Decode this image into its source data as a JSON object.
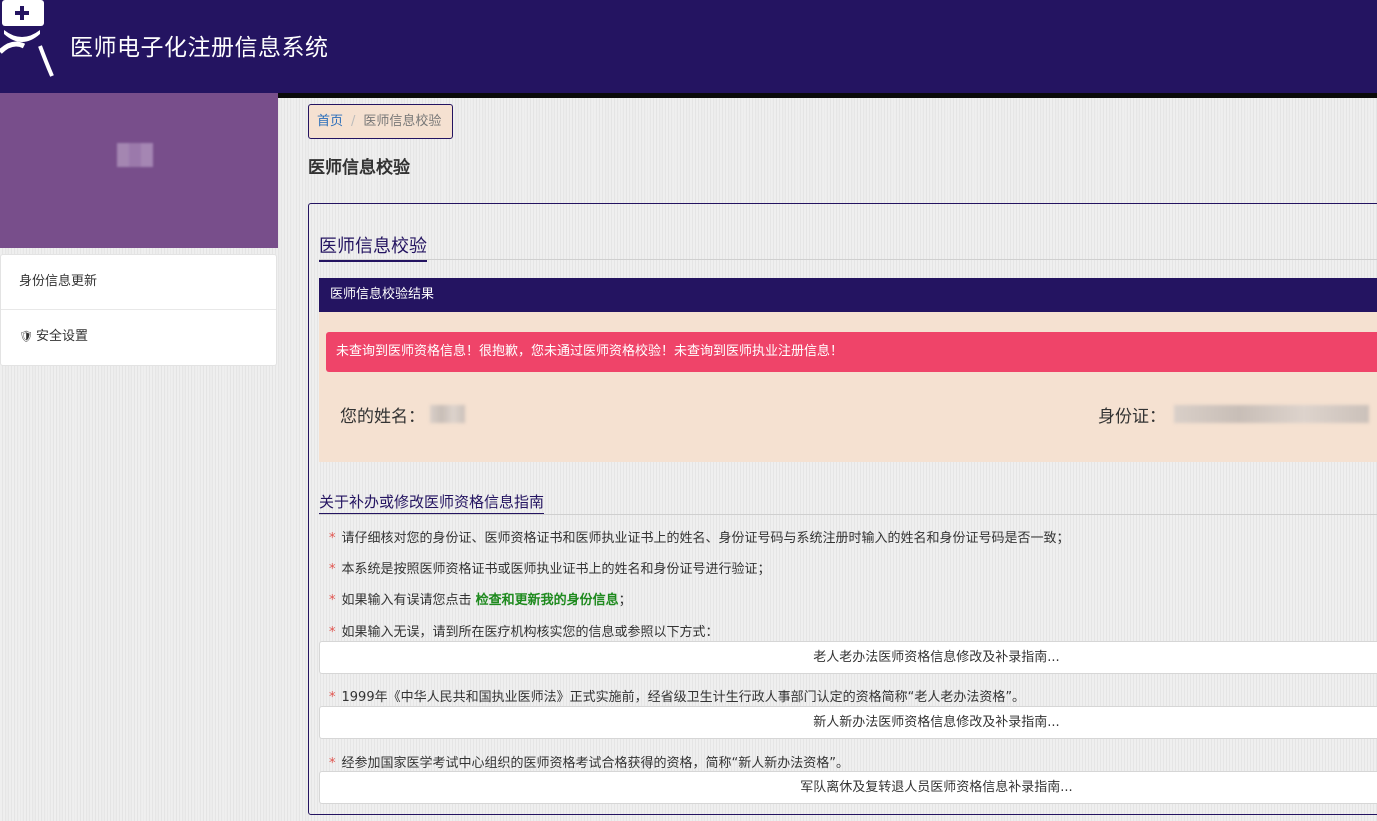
{
  "header": {
    "title": "医师电子化注册信息系统",
    "logo_icon": "doctor-icon"
  },
  "sidebar": {
    "items": [
      {
        "label": "身份信息更新",
        "icon": ""
      },
      {
        "label": "安全设置",
        "icon": "shield-icon"
      }
    ]
  },
  "breadcrumb": {
    "home": "首页",
    "separator": "/",
    "current": "医师信息校验"
  },
  "page": {
    "title": "医师信息校验"
  },
  "panel": {
    "section_title": "医师信息校验",
    "result_header": "医师信息校验结果",
    "alert": "未查询到医师资格信息！很抱歉，您未通过医师资格校验！未查询到医师执业注册信息！",
    "name_label": "您的姓名：",
    "id_label": "身份证："
  },
  "guide": {
    "title": "关于补办或修改医师资格信息指南",
    "star": "*",
    "item1": "请仔细核对您的身份证、医师资格证书和医师执业证书上的姓名、身份证号码与系统注册时输入的姓名和身份证号码是否一致；",
    "item2": "本系统是按照医师资格证书或医师执业证书上的姓名和身份证号进行验证；",
    "item3_prefix": "如果输入有误请您点击",
    "item3_link": "检查和更新我的身份信息",
    "item3_suffix": "；",
    "item4": "如果输入无误，请到所在医疗机构核实您的信息或参照以下方式：",
    "btn1": "老人老办法医师资格信息修改及补录指南...",
    "item5": "1999年《中华人民共和国执业医师法》正式实施前，经省级卫生计生行政人事部门认定的资格简称“老人老办法资格”。",
    "btn2": "新人新办法医师资格信息修改及补录指南...",
    "item6": "经参加国家医学考试中心组织的医师资格考试合格获得的资格，简称“新人新办法资格”。",
    "btn3": "军队离休及复转退人员医师资格信息补录指南..."
  },
  "colors": {
    "header": "#241461",
    "sidebar_profile": "#784e8b",
    "alert": "#ef4469",
    "result_bg": "#f5e1d1",
    "link_green": "#1e8a1e"
  }
}
